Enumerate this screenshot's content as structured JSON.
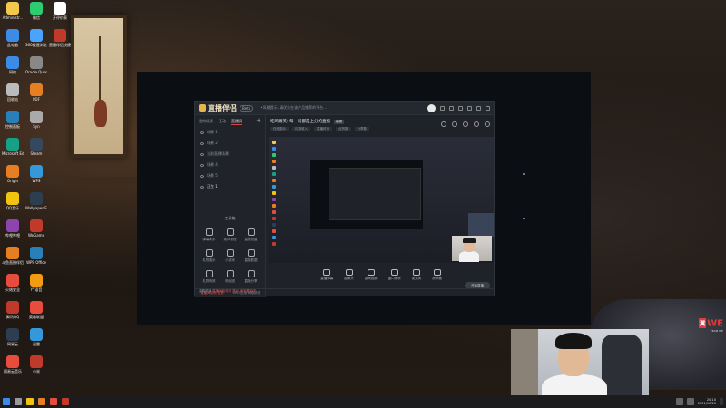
{
  "desktop": {
    "icons": [
      {
        "label": "Administr...",
        "color": "#f2c94c",
        "col": 0,
        "row": 0
      },
      {
        "label": "微信",
        "color": "#2ecc71",
        "col": 1,
        "row": 0
      },
      {
        "label": "开评价表",
        "color": "#ffffff",
        "col": 2,
        "row": 0
      },
      {
        "label": "此电脑",
        "color": "#3c8ce7",
        "col": 0,
        "row": 1
      },
      {
        "label": "360极速浏览器",
        "color": "#4aa3ff",
        "col": 1,
        "row": 1
      },
      {
        "label": "直播伴侣快捷方式",
        "color": "#c0392b",
        "col": 2,
        "row": 1
      },
      {
        "label": "网络",
        "color": "#3c8ce7",
        "col": 0,
        "row": 2
      },
      {
        "label": "Oracle Queries",
        "color": "#888888",
        "col": 1,
        "row": 2
      },
      {
        "label": "回收站",
        "color": "#bbbbbb",
        "col": 0,
        "row": 3
      },
      {
        "label": "PDF",
        "color": "#e67e22",
        "col": 1,
        "row": 3
      },
      {
        "label": "控制面板",
        "color": "#2980b9",
        "col": 0,
        "row": 4
      },
      {
        "label": "Syn",
        "color": "#aaaaaa",
        "col": 1,
        "row": 4
      },
      {
        "label": "Microsoft Edge",
        "color": "#16a085",
        "col": 0,
        "row": 5
      },
      {
        "label": "Steam",
        "color": "#34495e",
        "col": 1,
        "row": 5
      },
      {
        "label": "Origin",
        "color": "#e67e22",
        "col": 0,
        "row": 6
      },
      {
        "label": "WPS",
        "color": "#3498db",
        "col": 1,
        "row": 6
      },
      {
        "label": "QQ音乐",
        "color": "#f1c40f",
        "col": 0,
        "row": 7
      },
      {
        "label": "Wallpaper Engine",
        "color": "#2c3e50",
        "col": 1,
        "row": 7
      },
      {
        "label": "哔哩哔哩",
        "color": "#8e44ad",
        "col": 0,
        "row": 8
      },
      {
        "label": "WeGame",
        "color": "#c0392b",
        "col": 1,
        "row": 8
      },
      {
        "label": "斗鱼直播伴侣",
        "color": "#e67e22",
        "col": 0,
        "row": 9
      },
      {
        "label": "WPS Office",
        "color": "#2980b9",
        "col": 1,
        "row": 9
      },
      {
        "label": "火绒安全",
        "color": "#e74c3c",
        "col": 0,
        "row": 10
      },
      {
        "label": "YY语音",
        "color": "#f39c12",
        "col": 1,
        "row": 10
      },
      {
        "label": "腾讯QQ",
        "color": "#c0392b",
        "col": 0,
        "row": 11
      },
      {
        "label": "英雄联盟",
        "color": "#e74c3c",
        "col": 1,
        "row": 11
      },
      {
        "label": "网易云",
        "color": "#2c3e50",
        "col": 0,
        "row": 12
      },
      {
        "label": "迅雷",
        "color": "#3498db",
        "col": 1,
        "row": 12
      },
      {
        "label": "网易云音乐",
        "color": "#e74c3c",
        "col": 0,
        "row": 13
      },
      {
        "label": "小米",
        "color": "#c0392b",
        "col": 1,
        "row": 13
      }
    ]
  },
  "app": {
    "logo_text": "直播伴侣",
    "version_badge": "Beta",
    "title_notice": "•风格提示, 请优先在该产品推荐的平台…",
    "left_tabs": [
      "我的场景",
      "互动",
      "直播间"
    ],
    "active_tab_index": 2,
    "add_scene": "+",
    "scenes": [
      {
        "label": "场景 1",
        "active": false
      },
      {
        "label": "场景 2",
        "active": false
      },
      {
        "label": "当前直播场景",
        "active": false
      },
      {
        "label": "场景 4",
        "active": false
      },
      {
        "label": "场景 5",
        "active": false
      },
      {
        "label": "正在 1",
        "active": true
      }
    ],
    "tools_title": "工具箱",
    "tools": [
      {
        "label": "弹幕助手",
        "icon": "chat-icon"
      },
      {
        "label": "观众管理",
        "icon": "bell-icon"
      },
      {
        "label": "直播设置",
        "icon": "mic-icon"
      },
      {
        "label": "礼物展示",
        "icon": "gift-icon"
      },
      {
        "label": "小游戏",
        "icon": "game-icon"
      },
      {
        "label": "直播数据",
        "icon": "chart-icon"
      },
      {
        "label": "礼物特效",
        "icon": "star-icon"
      },
      {
        "label": "粉丝团",
        "icon": "heart-icon"
      },
      {
        "label": "直播分享",
        "icon": "share-icon"
      }
    ],
    "left_bottom_left": "金鹏频道",
    "left_bottom_notice": "直播间检测中 提示 请不要关闭",
    "room_title": "吃鸡精英: 每一局都是上分的直播",
    "room_tag": "编辑",
    "room_stats": [
      "在线观众",
      "礼物收入",
      "直播时长",
      "点赞数",
      "分享数"
    ],
    "bottom_actions": [
      {
        "label": "直播弹幕",
        "icon": "danmu-icon"
      },
      {
        "label": "摄像头",
        "icon": "camera-icon"
      },
      {
        "label": "游戏投屏",
        "icon": "screen-icon"
      },
      {
        "label": "窗口捕获",
        "icon": "window-icon"
      },
      {
        "label": "麦克风",
        "icon": "mic-icon"
      },
      {
        "label": "扬声器",
        "icon": "speaker-icon"
      }
    ],
    "start_button": "开始直播",
    "status_left": "直播间检测 正常",
    "status_right": "CPU 占用 网络状态"
  },
  "webcam": {
    "visible": true
  },
  "watermark": {
    "left": "翼",
    "brand": "WE",
    "sub": "TEAM WE"
  },
  "taskbar": {
    "pinned": [
      {
        "name": "start",
        "color": "#3c8ce7"
      },
      {
        "name": "search",
        "color": "#999999"
      },
      {
        "name": "chrome",
        "color": "#f1c40f"
      },
      {
        "name": "explorer",
        "color": "#e67e22"
      },
      {
        "name": "app",
        "color": "#e74c3c"
      },
      {
        "name": "app2",
        "color": "#c0392b"
      }
    ],
    "time": "20:10",
    "date": "2021/10/26"
  }
}
